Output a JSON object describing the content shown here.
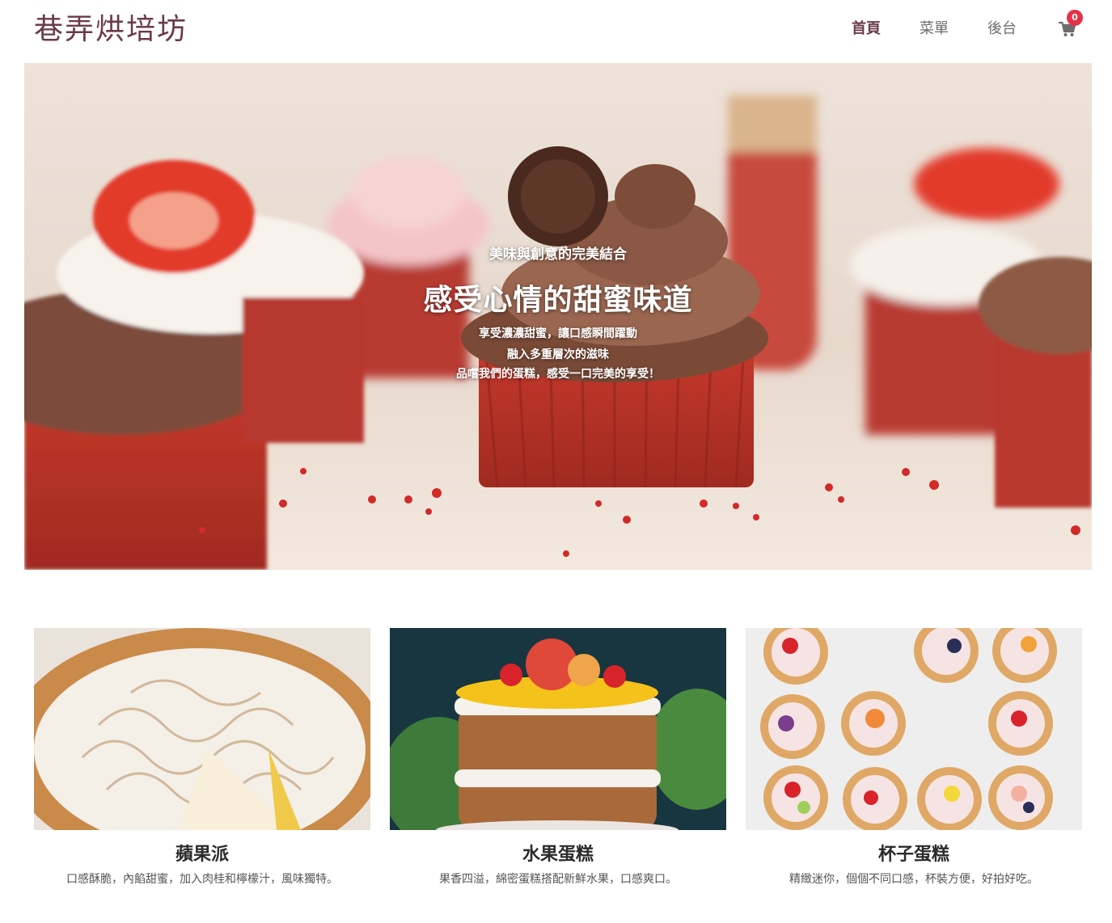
{
  "header": {
    "brand": "巷弄烘培坊",
    "nav": [
      {
        "label": "首頁",
        "active": true
      },
      {
        "label": "菜單",
        "active": false
      },
      {
        "label": "後台",
        "active": false
      }
    ],
    "cart": {
      "icon": "cart-icon",
      "count": "0"
    }
  },
  "hero": {
    "eyebrow": "美味與創意的完美結合",
    "title": "感受心情的甜蜜味道",
    "lines": [
      "享受濃濃甜蜜，讓口感瞬間躍動",
      "融入多重層次的滋味",
      "品嚐我們的蛋糕，感受一口完美的享受！"
    ],
    "image": "cupcakes-with-strawberries-photo"
  },
  "products": [
    {
      "name": "蘋果派",
      "desc": "口感酥脆，內餡甜蜜，加入肉桂和檸檬汁，風味獨特。",
      "image": "meringue-pie-photo"
    },
    {
      "name": "水果蛋糕",
      "desc": "果香四溢，綿密蛋糕搭配新鮮水果，口感爽口。",
      "image": "fruit-layer-cake-photo"
    },
    {
      "name": "杯子蛋糕",
      "desc": "精緻迷你，個個不同口感，杯裝方便，好拍好吃。",
      "image": "decorated-mini-tarts-photo"
    }
  ],
  "colors": {
    "brand": "#6b3a4a",
    "badge": "#e3324a",
    "nav_text": "#6d6d6d"
  }
}
